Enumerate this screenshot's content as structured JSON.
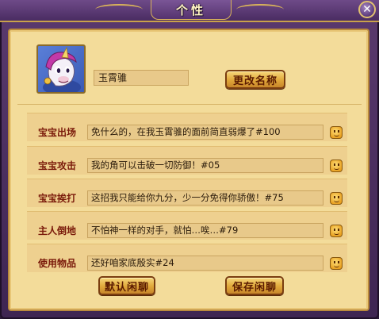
{
  "window": {
    "title": "个性",
    "close_icon": "close-icon"
  },
  "pet": {
    "avatar_icon": "unicorn-pet-avatar",
    "name": "玉霄骓",
    "rename_label": "更改名称"
  },
  "chat_rows": [
    {
      "label": "宝宝出场",
      "text": "免什么的，在我玉霄骓的面前简直弱爆了#100",
      "emote_icon": "emoticon-icon"
    },
    {
      "label": "宝宝攻击",
      "text": "我的角可以击破一切防御！#05",
      "emote_icon": "emoticon-icon"
    },
    {
      "label": "宝宝挨打",
      "text": "这招我只能给你九分，少一分免得你骄傲！#75",
      "emote_icon": "emoticon-icon"
    },
    {
      "label": "主人倒地",
      "text": "不怕神一样的对手，就怕…唉…#79",
      "emote_icon": "emoticon-icon"
    },
    {
      "label": "使用物品",
      "text": "还好咱家底殷实#24",
      "emote_icon": "emoticon-icon"
    }
  ],
  "footer": {
    "default_label": "默认闲聊",
    "save_label": "保存闲聊"
  },
  "colors": {
    "panel": "#f3dc9a",
    "frame": "#4a2c62",
    "label_text": "#7a1a0a",
    "button": "#e0a83a"
  }
}
